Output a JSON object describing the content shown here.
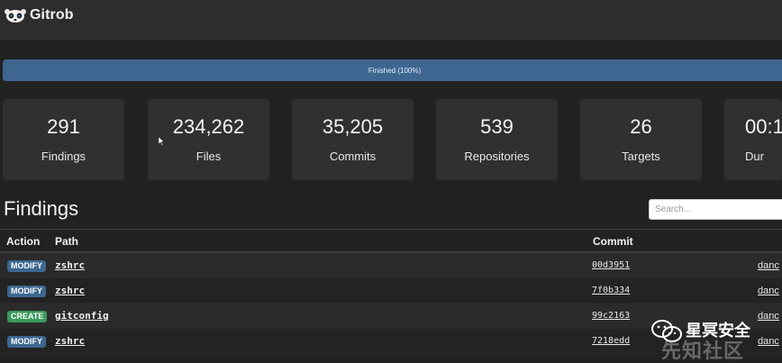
{
  "app": {
    "title": "Gitrob",
    "logo_icon": "panda-icon"
  },
  "progress": {
    "label": "Finished (100%)",
    "percent": 100,
    "color": "#3e6691"
  },
  "stats": [
    {
      "value": "291",
      "label": "Findings"
    },
    {
      "value": "234,262",
      "label": "Files"
    },
    {
      "value": "35,205",
      "label": "Commits"
    },
    {
      "value": "539",
      "label": "Repositories"
    },
    {
      "value": "26",
      "label": "Targets"
    },
    {
      "value": "00:1",
      "label": "Dur"
    }
  ],
  "findings": {
    "title": "Findings",
    "search_placeholder": "Search...",
    "columns": {
      "action": "Action",
      "path": "Path",
      "commit": "Commit"
    },
    "rows": [
      {
        "action": "MODIFY",
        "path": "zshrc",
        "commit": "00d3951",
        "author": "danc"
      },
      {
        "action": "MODIFY",
        "path": "zshrc",
        "commit": "7f0b334",
        "author": "danc"
      },
      {
        "action": "CREATE",
        "path": "gitconfig",
        "commit": "99c2163",
        "author": "danc"
      },
      {
        "action": "MODIFY",
        "path": "zshrc",
        "commit": "7218edd",
        "author": "danc"
      }
    ]
  },
  "watermark": {
    "line1": "星冥安全",
    "line2": "先知社区"
  },
  "colors": {
    "background": "#222222",
    "modify_badge": "#3c6790",
    "create_badge": "#3a9a5c"
  }
}
